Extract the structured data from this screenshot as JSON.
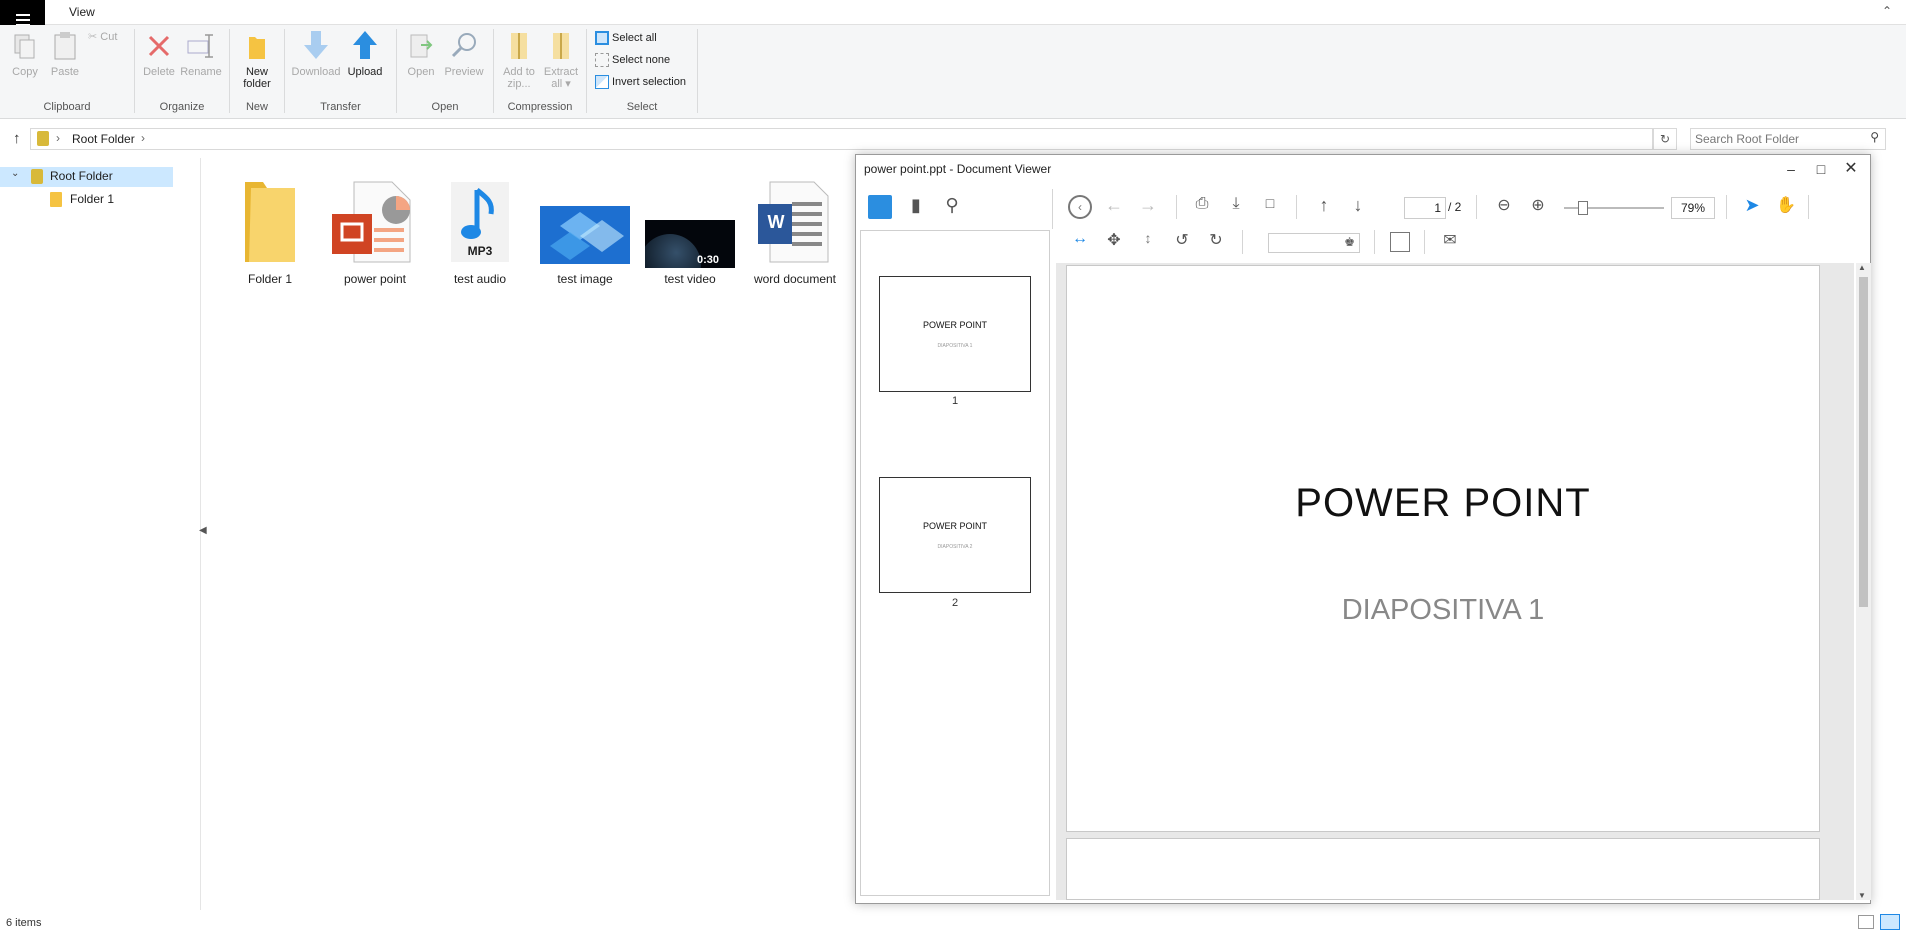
{
  "ribbon": {
    "tab_view": "View",
    "groups": {
      "clipboard": "Clipboard",
      "organize": "Organize",
      "new": "New",
      "transfer": "Transfer",
      "open": "Open",
      "compression": "Compression",
      "select": "Select"
    },
    "buttons": {
      "copy": "Copy",
      "paste": "Paste",
      "cut": "Cut",
      "delete": "Delete",
      "rename": "Rename",
      "new_folder_1": "New",
      "new_folder_2": "folder",
      "download": "Download",
      "upload": "Upload",
      "open": "Open",
      "preview": "Preview",
      "add_zip_1": "Add to",
      "add_zip_2": "zip...",
      "extract_1": "Extract",
      "extract_2": "all",
      "select_all": "Select all",
      "select_none": "Select none",
      "invert_selection": "Invert selection"
    }
  },
  "address": {
    "crumb": "Root Folder",
    "search_placeholder": "Search Root Folder"
  },
  "tree": {
    "root": "Root Folder",
    "child": "Folder 1"
  },
  "files": [
    {
      "name": "Folder 1"
    },
    {
      "name": "power point"
    },
    {
      "name": "test audio",
      "badge": "MP3"
    },
    {
      "name": "test image"
    },
    {
      "name": "test video",
      "duration": "0:30"
    },
    {
      "name": "word document",
      "badge": "W"
    }
  ],
  "status": {
    "items": "6 items"
  },
  "viewer": {
    "title": "power point.ppt - Document Viewer",
    "page_current": "1",
    "page_total": "/ 2",
    "zoom": "79%",
    "zoom_level": 0.15,
    "thumbs": [
      {
        "num": "1",
        "title": "POWER POINT",
        "sub": "DIAPOSITIVA 1"
      },
      {
        "num": "2",
        "title": "POWER POINT",
        "sub": "DIAPOSITIVA 2"
      }
    ],
    "slide_title": "POWER POINT",
    "slide_sub": "DIAPOSITIVA 1"
  },
  "colors": {
    "accent": "#1e88e5",
    "selection": "#cce8ff",
    "delete_red": "#e53935"
  }
}
